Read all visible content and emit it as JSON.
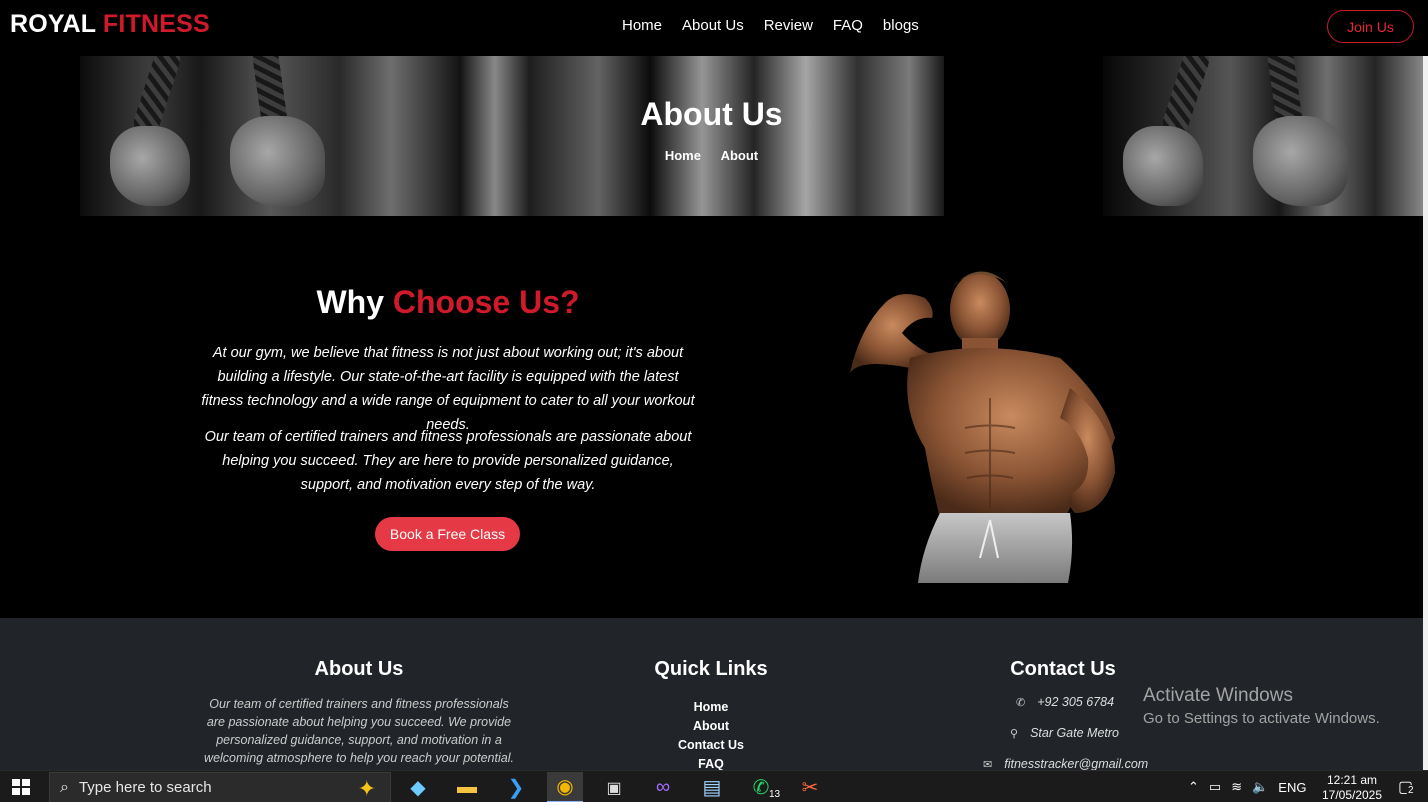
{
  "nav": {
    "brand_part1": "ROYAL",
    "brand_part2": "FITNESS",
    "links": [
      "Home",
      "About Us",
      "Review",
      "FAQ",
      "blogs"
    ],
    "join_label": "Join Us"
  },
  "hero": {
    "title": "About Us",
    "breadcrumb": [
      "Home",
      "About"
    ]
  },
  "why": {
    "title_part1": "Why",
    "title_part2": "Choose Us?",
    "paragraph1": "At our gym, we believe that fitness is not just about working out; it's about building a lifestyle. Our state-of-the-art facility is equipped with the latest fitness technology and a wide range of equipment to cater to all your workout needs.",
    "paragraph2": "Our team of certified trainers and fitness professionals are passionate about helping you succeed. They are here to provide personalized guidance, support, and motivation every step of the way.",
    "cta_label": "Book a Free Class"
  },
  "footer": {
    "about_title": "About Us",
    "about_text": "Our team of certified trainers and fitness professionals are passionate about helping you succeed. We provide personalized guidance, support, and motivation in a welcoming atmosphere to help you reach your potential.",
    "links_title": "Quick Links",
    "links": [
      "Home",
      "About",
      "Contact Us",
      "FAQ"
    ],
    "contact_title": "Contact Us",
    "phone": "+92 305 6784",
    "address": "Star Gate Metro",
    "email": "fitnesstracker@gmail.com"
  },
  "watermark": {
    "line1": "Activate Windows",
    "line2": "Go to Settings to activate Windows."
  },
  "taskbar": {
    "search_placeholder": "Type here to search",
    "whatsapp_badge": "13",
    "language": "ENG",
    "time": "12:21 am",
    "date": "17/05/2025",
    "notification_count": "2"
  },
  "colors": {
    "accent_red": "#d01a2b",
    "button_red": "#e63946",
    "footer_bg": "#212529"
  }
}
